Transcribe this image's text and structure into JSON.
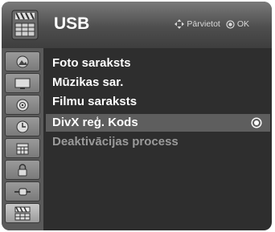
{
  "header": {
    "title": "USB",
    "icon": "usb-menu-icon",
    "hint": {
      "move_label": "Pārvietot",
      "ok_label": "OK"
    }
  },
  "sidebar": {
    "items": [
      {
        "icon": "picture-icon"
      },
      {
        "icon": "screen-icon"
      },
      {
        "icon": "audio-icon"
      },
      {
        "icon": "clock-icon"
      },
      {
        "icon": "calendar-icon"
      },
      {
        "icon": "lock-icon"
      },
      {
        "icon": "input-icon"
      },
      {
        "icon": "usb-icon",
        "active": true
      }
    ]
  },
  "menu": {
    "items": [
      {
        "label": "Foto saraksts"
      },
      {
        "label": "Mūzikas sar."
      },
      {
        "label": "Filmu saraksts"
      },
      {
        "label": "DivX reģ. Kods",
        "selected": true
      },
      {
        "label": "Deaktivācijas process",
        "disabled": true
      }
    ]
  },
  "colors": {
    "panel": "#2e2e2e",
    "selected_row": "#5e5e5e",
    "disabled_text": "#9a9a9a"
  }
}
